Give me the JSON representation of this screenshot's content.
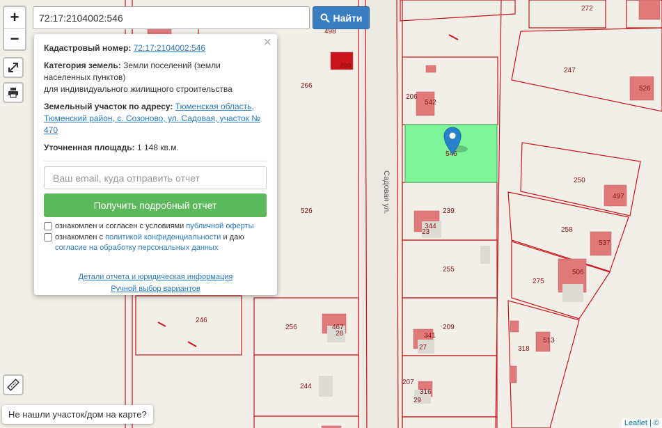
{
  "map": {
    "street_label": "Садовая ул.",
    "selected_parcel_label": "546",
    "parcel_labels": [
      "498",
      "499",
      "266",
      "272",
      "247",
      "526",
      "206",
      "542",
      "526",
      "239",
      "344",
      "23",
      "250",
      "497",
      "258",
      "537",
      "255",
      "275",
      "506",
      "246",
      "256",
      "467",
      "28",
      "209",
      "341",
      "27",
      "318",
      "513",
      "244",
      "207",
      "316",
      "29"
    ],
    "colors": {
      "parcel_border": "#c9141b",
      "building": "#e07a7a",
      "selected": "#7ff59a",
      "marker": "#2a81cb"
    }
  },
  "controls": {
    "zoom_in": "+",
    "zoom_out": "−",
    "fullscreen_icon": "expand-icon",
    "print_icon": "print-icon",
    "ruler_icon": "ruler-icon"
  },
  "search": {
    "value": "72:17:2104002:546",
    "button_label": "Найти"
  },
  "popup": {
    "close_label": "×",
    "cadastral_label": "Кадастровый номер:",
    "cadastral_value": "72:17:2104002:546",
    "category_label": "Категория земель:",
    "category_value": "Земли поселений (земли населенных пунктов)",
    "category_purpose": "для индивидуального жилищного строительства",
    "address_label": "Земельный участок по адресу:",
    "address_value": "Тюменская область, Тюменский район, с. Созоново, ул. Садовая, участок № 470",
    "area_label": "Уточненная площадь:",
    "area_value": "1 148 кв.м.",
    "email_placeholder": "Ваш email, куда отправить отчет",
    "report_button": "Получить подробный отчет",
    "consent1_text": "ознакомлен и согласен с условиями ",
    "consent1_link": "публичной оферты",
    "consent2_text": "ознакомлен с ",
    "consent2_link": "политикой конфиденциальности",
    "consent2_mid": " и даю ",
    "consent2_link2": "согласие на обработку персональных данных",
    "details_link": "Детали отчета и юридическая информация",
    "manual_link": "Ручной выбор вариантов"
  },
  "not_found_label": "Не нашли участок/дом на карте?",
  "attribution": "Leaflet | ©"
}
